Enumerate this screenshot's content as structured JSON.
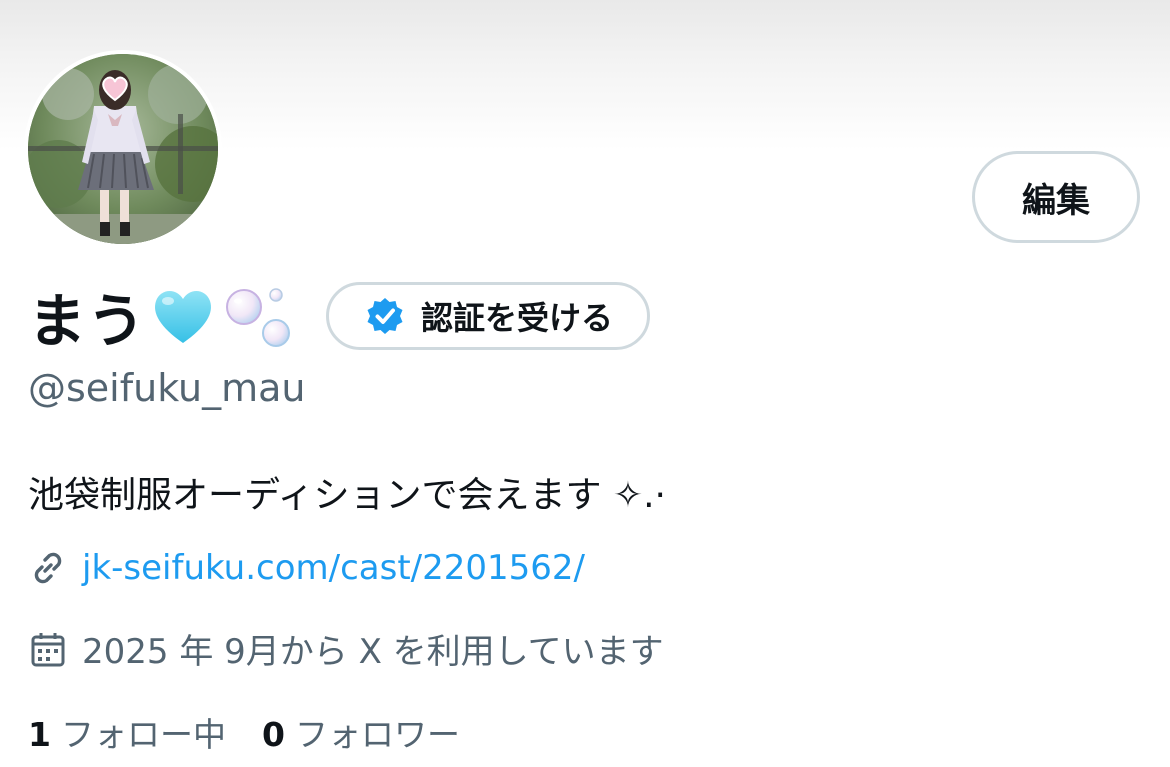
{
  "profile": {
    "display_name": "まう",
    "handle": "@seifuku_mau",
    "bio": "池袋制服オーディションで会えます ✧.·",
    "link": "jk-seifuku.com/cast/2201562/",
    "joined": "2025 年 9月から X を利用しています"
  },
  "actions": {
    "edit_label": "編集",
    "verify_label": "認証を受ける"
  },
  "stats": {
    "following_count": "1",
    "following_label": "フォロー中",
    "followers_count": "0",
    "followers_label": "フォロワー"
  },
  "icons": {
    "name_emoji_1": "light-blue-heart-icon",
    "name_emoji_2": "bubbles-icon",
    "verify_badge": "verified-badge-icon",
    "link": "link-icon",
    "calendar": "calendar-icon"
  },
  "colors": {
    "link": "#1d9bf0",
    "secondary_text": "#536471",
    "border": "#cfd9de",
    "verified_blue": "#1d9bf0"
  }
}
